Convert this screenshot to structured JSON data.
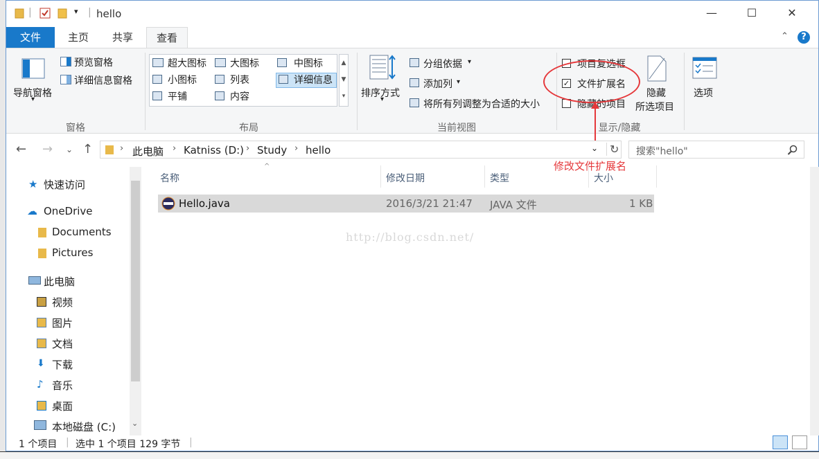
{
  "window": {
    "title": "hello"
  },
  "tabs": {
    "file": "文件",
    "home": "主页",
    "share": "共享",
    "view": "查看",
    "help": "?"
  },
  "ribbon": {
    "panes": {
      "nav_pane": "导航窗格",
      "preview_pane": "预览窗格",
      "details_pane": "详细信息窗格",
      "label": "窗格"
    },
    "layout": {
      "extra_large": "超大图标",
      "large": "大图标",
      "medium": "中图标",
      "small": "小图标",
      "list": "列表",
      "details": "详细信息",
      "tiles": "平铺",
      "content": "内容",
      "label": "布局"
    },
    "current_view": {
      "sort_by": "排序方式",
      "group_by": "分组依据",
      "add_columns": "添加列",
      "size_all_columns": "将所有列调整为合适的大小",
      "label": "当前视图"
    },
    "show_hide": {
      "item_checkboxes": "项目复选框",
      "item_checkboxes_checked": false,
      "file_extensions": "文件扩展名",
      "file_extensions_checked": true,
      "hidden_items": "隐藏的项目",
      "hidden_items_checked": false,
      "hide_selected_line1": "隐藏",
      "hide_selected_line2": "所选项目",
      "label": "显示/隐藏"
    },
    "options": "选项"
  },
  "annotation": {
    "text": "修改文件扩展名",
    "color": "#e5383b"
  },
  "address": {
    "crumbs": [
      "此电脑",
      "Katniss (D:)",
      "Study",
      "hello"
    ],
    "search_placeholder": "搜索\"hello\""
  },
  "nav": {
    "quick_access": "快速访问",
    "onedrive": "OneDrive",
    "documents": "Documents",
    "pictures": "Pictures",
    "this_pc": "此电脑",
    "videos": "视频",
    "images": "图片",
    "docs": "文档",
    "downloads": "下载",
    "music": "音乐",
    "desktop": "桌面",
    "local_disk": "本地磁盘 (C:)"
  },
  "columns": {
    "name": "名称",
    "modified": "修改日期",
    "type": "类型",
    "size": "大小"
  },
  "files": [
    {
      "name": "Hello.java",
      "modified": "2016/3/21 21:47",
      "type": "JAVA 文件",
      "size": "1 KB"
    }
  ],
  "watermark": "http://blog.csdn.net/",
  "status": {
    "count": "1 个项目",
    "selected": "选中 1 个项目  129 字节"
  },
  "colors": {
    "accent": "#1979ca",
    "ribbon_bg": "#f5f6f7",
    "selection": "#d9d9d9"
  }
}
